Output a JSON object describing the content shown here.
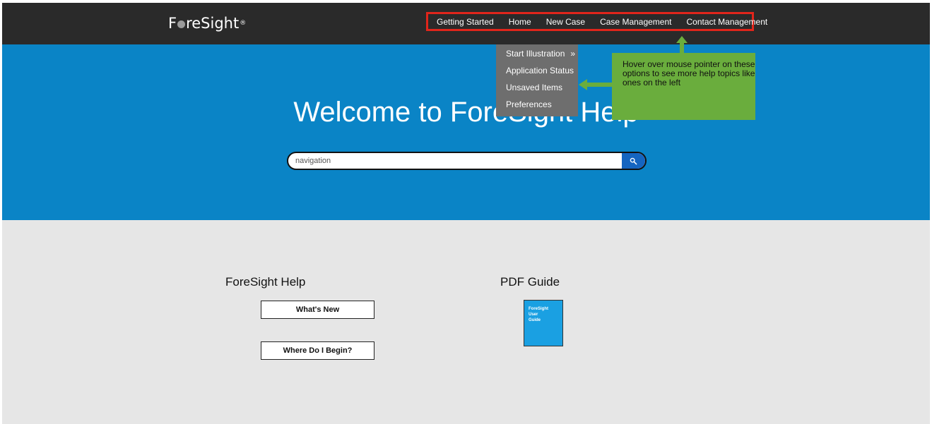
{
  "header": {
    "logo": {
      "pre": "F",
      "post": "reSight",
      "reg": "®"
    },
    "nav": [
      {
        "label": "Getting Started"
      },
      {
        "label": "Home"
      },
      {
        "label": "New Case"
      },
      {
        "label": "Case Management"
      },
      {
        "label": "Contact Management"
      }
    ]
  },
  "hero": {
    "title": "Welcome to ForeSight Help",
    "search": {
      "value": "navigation",
      "icon": "search-icon"
    }
  },
  "dropdown": {
    "items": [
      {
        "label": "Start Illustration",
        "arrow": "»"
      },
      {
        "label": "Application Status"
      },
      {
        "label": "Unsaved Items"
      },
      {
        "label": "Preferences"
      }
    ]
  },
  "callout": {
    "text": "Hover over mouse pointer on these options to see more help topics like ones on the left",
    "color": "#6aad3d"
  },
  "help": {
    "title": "ForeSight Help",
    "buttons": [
      {
        "label": "What's New"
      },
      {
        "label": "Where Do I Begin?"
      }
    ]
  },
  "pdf": {
    "title": "PDF Guide",
    "book_lines": [
      "ForeSight",
      "User",
      "Guide"
    ]
  },
  "colors": {
    "topbar": "#2a2a2a",
    "hero": "#0a84c6",
    "highlight_border": "#e1251b",
    "lower_bg": "#e6e6e6"
  }
}
